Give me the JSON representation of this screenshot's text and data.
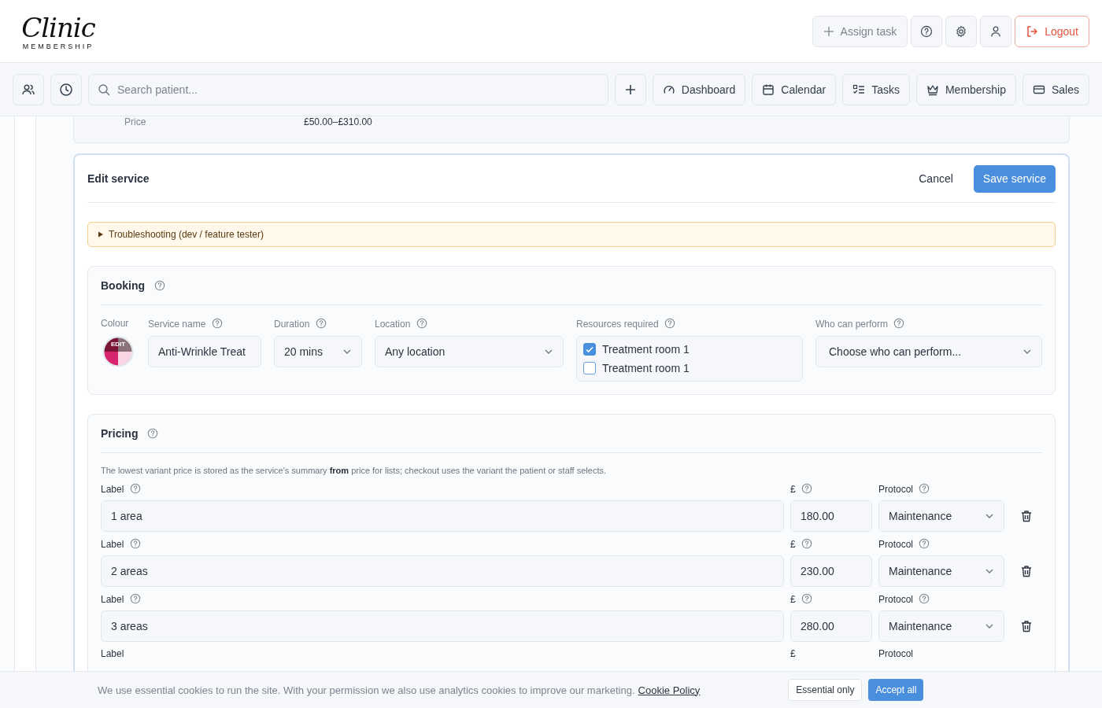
{
  "header": {
    "logo_script": "Clinic",
    "logo_sub": "MEMBERSHIP",
    "actions": [
      {
        "kind": "assign",
        "label": "Assign task"
      },
      {
        "kind": "help"
      },
      {
        "kind": "settings"
      },
      {
        "kind": "user"
      },
      {
        "kind": "logout",
        "label": "Logout"
      }
    ]
  },
  "toolbar": {
    "search": {
      "placeholder": "Search patient..."
    },
    "nav": [
      {
        "label": "Dashboard"
      },
      {
        "label": "Calendar"
      },
      {
        "label": "Tasks"
      },
      {
        "label": "Membership"
      },
      {
        "label": "Sales"
      }
    ]
  },
  "summary": {
    "label": "Price",
    "value": "£50.00–£310.00"
  },
  "edit": {
    "title": "Edit service",
    "cancel": "Cancel",
    "save": "Save service",
    "troubleshooting": "Troubleshooting (dev / feature tester)",
    "booking": {
      "title": "Booking",
      "colour": {
        "label": "Colour",
        "edit": "EDIT",
        "swatches": [
          {
            "color": "#7a1538"
          },
          {
            "color": "#8a7378"
          },
          {
            "color": "#d6246e"
          },
          {
            "color": "#f9d4e2"
          }
        ]
      },
      "service_name": {
        "label": "Service name",
        "value": "Anti-Wrinkle Treat"
      },
      "duration": {
        "label": "Duration",
        "value": "20 mins"
      },
      "location": {
        "label": "Location",
        "value": "Any location"
      },
      "resources": {
        "label": "Resources required",
        "items": [
          {
            "label": "Treatment room 1",
            "checked": true
          },
          {
            "label": "Treatment room 1",
            "checked": false
          }
        ]
      },
      "performers": {
        "label": "Who can perform",
        "value": "Choose who can perform..."
      }
    },
    "pricing": {
      "title": "Pricing",
      "note": "The lowest variant price is stored as the service's summary **from** price for lists; checkout uses the variant the patient or staff selects.",
      "variants": [
        {
          "label_title": "Label",
          "label": "1 area",
          "price_title": "£",
          "price": "180.00",
          "protocol_title": "Protocol",
          "protocol": "Maintenance"
        },
        {
          "label_title": "Label",
          "label": "2 areas",
          "price_title": "£",
          "price": "230.00",
          "protocol_title": "Protocol",
          "protocol": "Maintenance"
        },
        {
          "label_title": "Label",
          "label": "3 areas",
          "price_title": "£",
          "price": "280.00",
          "protocol_title": "Protocol",
          "protocol": "Maintenance"
        }
      ],
      "cut_row": {
        "label_title": "Label",
        "price_title": "£",
        "protocol_title": "Protocol"
      }
    }
  },
  "cookies": {
    "text": "We use essential cookies to run the site. With your permission we also use analytics cookies to improve our marketing.",
    "link": "Cookie Policy",
    "essential": "Essential only",
    "accept": "Accept all"
  }
}
